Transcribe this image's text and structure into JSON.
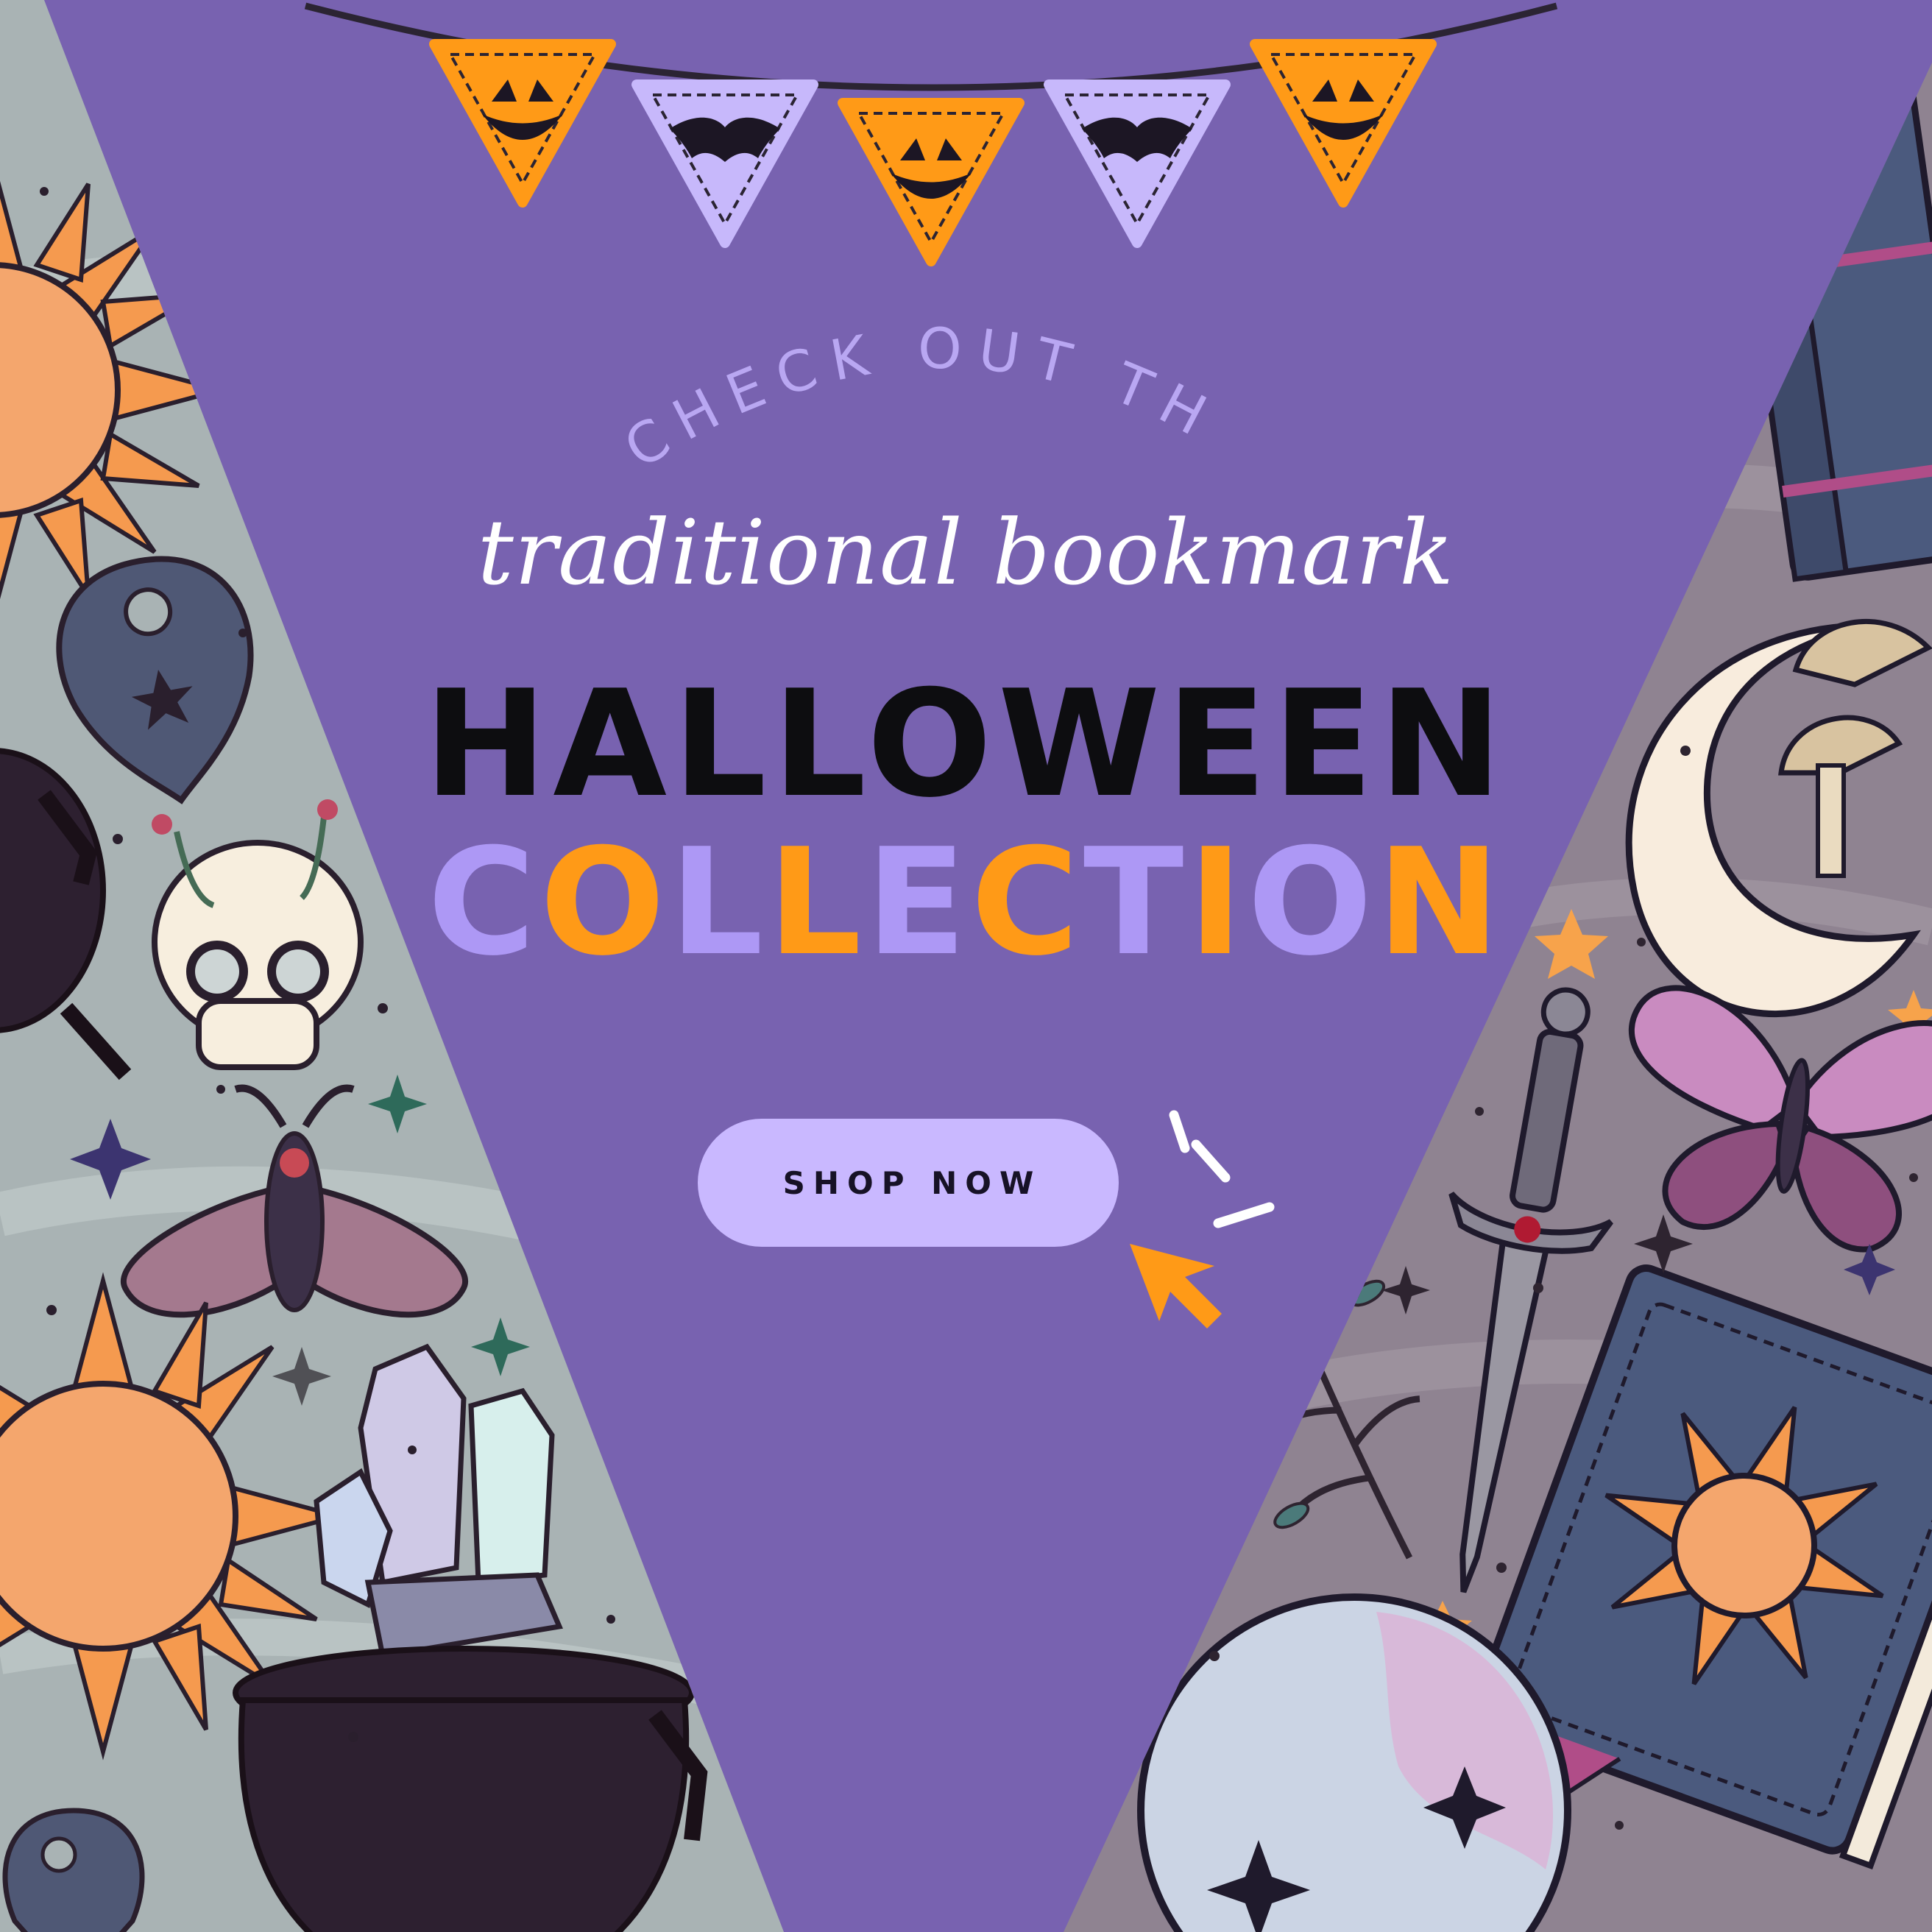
{
  "promo": {
    "intro_text": "CHECK OUT THE",
    "subtitle": "traditional bookmark",
    "title_line1": "HALLOWEEN",
    "title_line2_letters": [
      "C",
      "O",
      "L",
      "L",
      "E",
      "C",
      "T",
      "I",
      "O",
      "N"
    ],
    "cta_label": "SHOP NOW"
  },
  "colors": {
    "background": "#7862b0",
    "lavender": "#ad98f5",
    "orange": "#ff9a17",
    "button": "#c9b8ff",
    "title_dark": "#0d0d10",
    "panel_left": "#a9b3b4",
    "panel_right": "#8f8391"
  },
  "collection_letter_colors": [
    "#ad98f5",
    "#ff9a17",
    "#ad98f5",
    "#ff9a17",
    "#ad98f5",
    "#ff9a17",
    "#ad98f5",
    "#ff9a17",
    "#ad98f5",
    "#ff9a17"
  ],
  "bunting_flags": [
    {
      "type": "jack-o-lantern",
      "color": "#ff9a17"
    },
    {
      "type": "bat",
      "color": "#c7b8fb"
    },
    {
      "type": "jack-o-lantern",
      "color": "#ff9a17"
    },
    {
      "type": "bat",
      "color": "#c7b8fb"
    },
    {
      "type": "jack-o-lantern",
      "color": "#ff9a17"
    }
  ],
  "left_panel_icons": [
    "sun-icon",
    "planchette-icon",
    "cauldron-icon",
    "skull-icon",
    "moth-icon",
    "sun-icon",
    "crystal-icon",
    "cauldron-icon",
    "planchette-icon",
    "sparkle-icon"
  ],
  "right_panel_icons": [
    "book-icon",
    "moon-icon",
    "mushroom-icon",
    "dagger-icon",
    "butterfly-icon",
    "spellbook-icon",
    "crystal-ball-icon",
    "branch-icon",
    "star-icon",
    "sparkle-icon"
  ]
}
